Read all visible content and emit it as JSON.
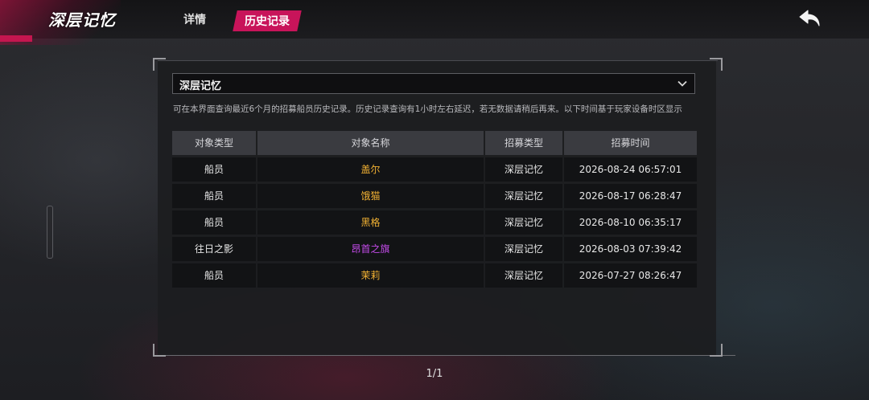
{
  "header": {
    "game_title": "深层记忆",
    "tabs": [
      {
        "label": "详情",
        "active": false
      },
      {
        "label": "历史记录",
        "active": true
      }
    ],
    "back_icon": "back-arrow-icon"
  },
  "filter": {
    "selected": "深层记忆",
    "icon": "chevron-down-icon"
  },
  "notice": "可在本界面查询最近6个月的招募船员历史记录。历史记录查询有1小时左右延迟，若无数据请稍后再来。以下时间基于玩家设备时区显示",
  "table": {
    "columns": [
      "对象类型",
      "对象名称",
      "招募类型",
      "招募时间"
    ],
    "rows": [
      {
        "type": "船员",
        "name": "盖尔",
        "name_color": "#f0b033",
        "recruit_type": "深层记忆",
        "time": "2026-08-24 06:57:01"
      },
      {
        "type": "船员",
        "name": "饿猫",
        "name_color": "#f0b033",
        "recruit_type": "深层记忆",
        "time": "2026-08-17 06:28:47"
      },
      {
        "type": "船员",
        "name": "黑格",
        "name_color": "#f0b033",
        "recruit_type": "深层记忆",
        "time": "2026-08-10 06:35:17"
      },
      {
        "type": "往日之影",
        "name": "昂首之旗",
        "name_color": "#c44bea",
        "recruit_type": "深层记忆",
        "time": "2026-08-03 07:39:42"
      },
      {
        "type": "船员",
        "name": "茉莉",
        "name_color": "#f0b033",
        "recruit_type": "深层记忆",
        "time": "2026-07-27 08:26:47"
      }
    ]
  },
  "pagination": "1/1",
  "colors": {
    "accent": "#c8145a",
    "gold_rarity": "#f0b033",
    "purple_rarity": "#c44bea"
  }
}
